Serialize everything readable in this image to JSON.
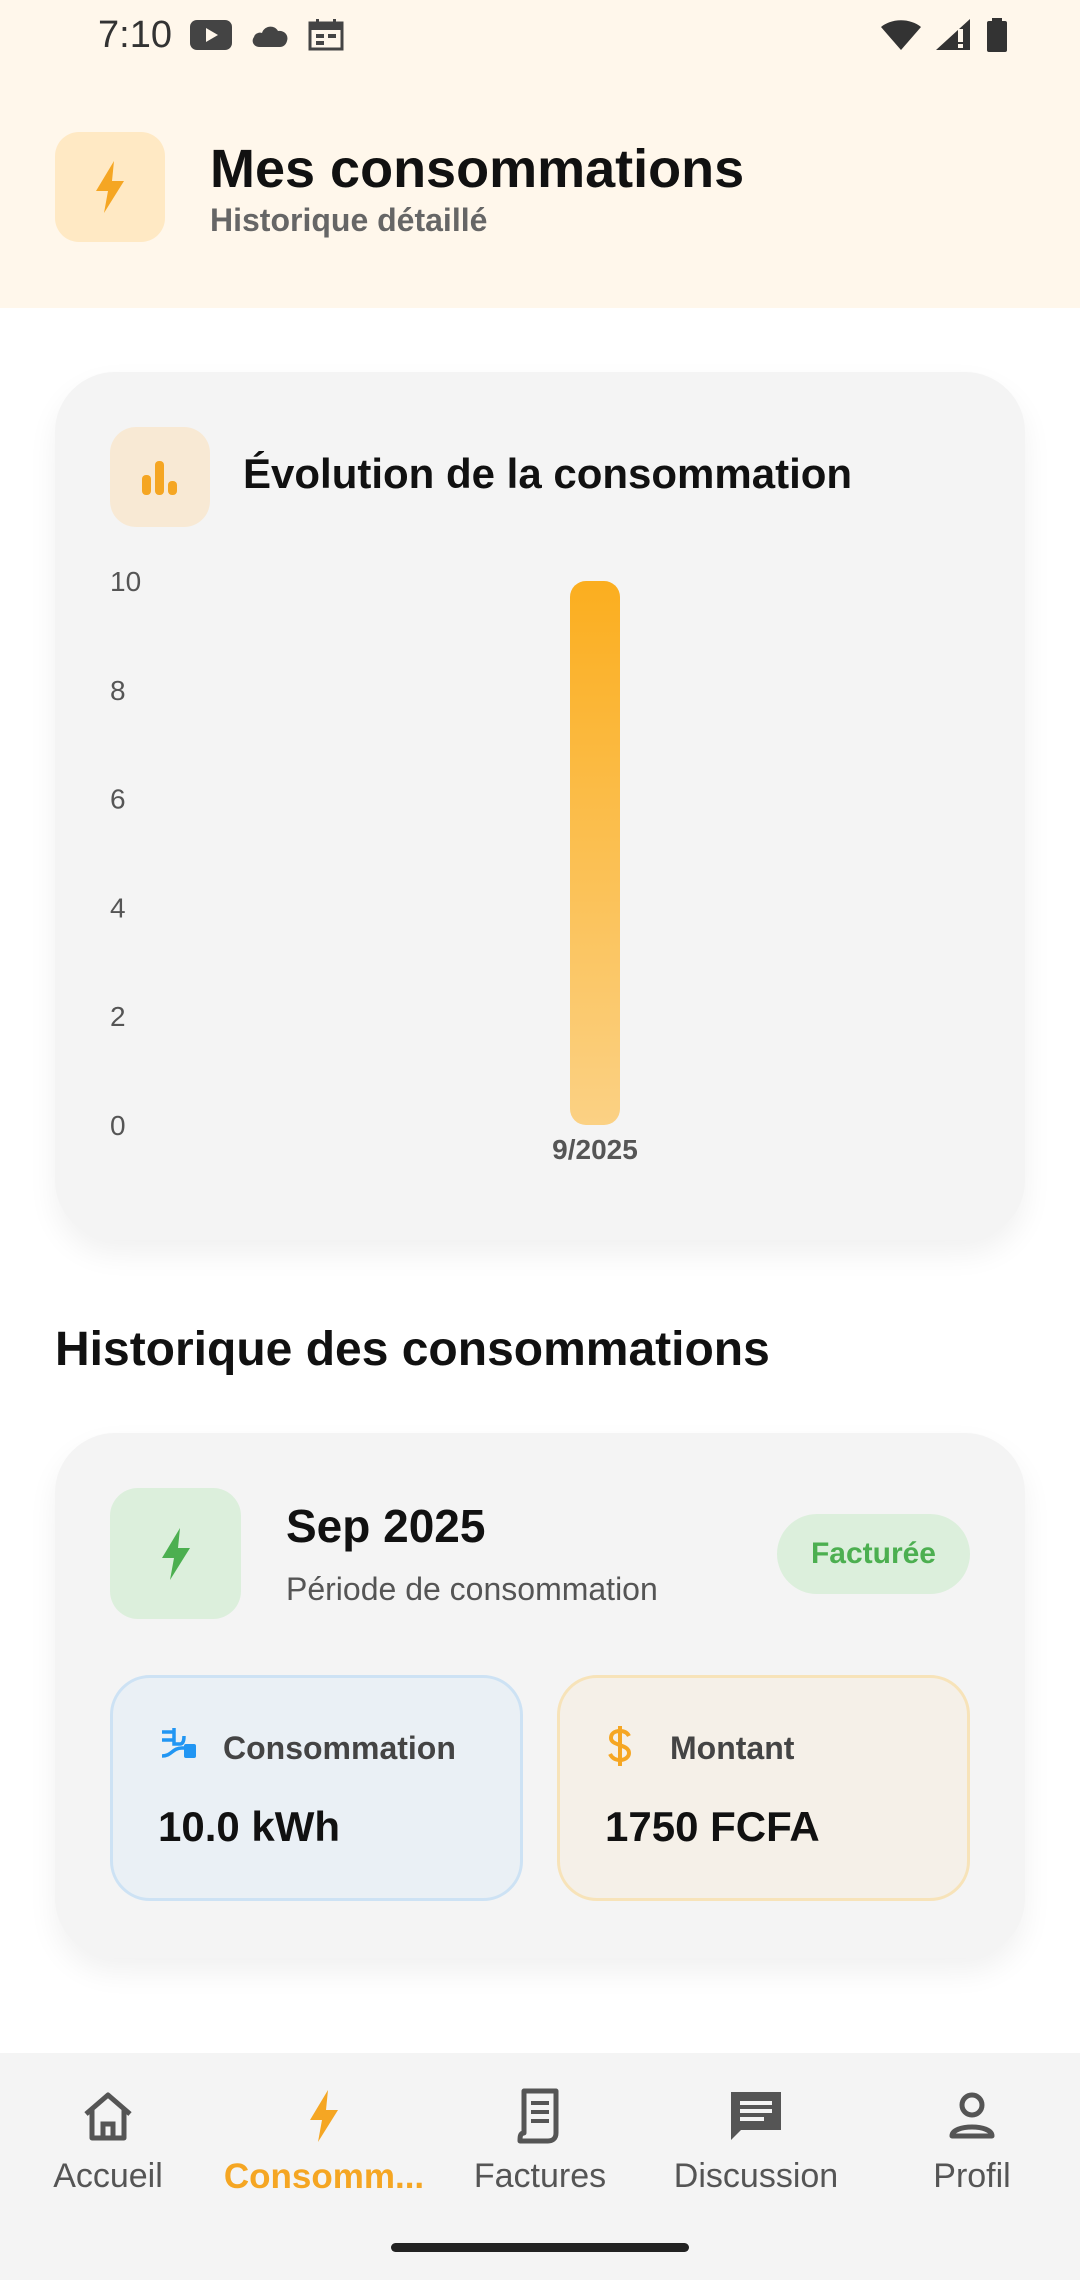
{
  "status_bar": {
    "time": "7:10"
  },
  "header": {
    "title": "Mes consommations",
    "subtitle": "Historique détaillé",
    "icon": "bolt-icon"
  },
  "chart_card": {
    "title": "Évolution de la consommation",
    "icon": "bar-chart-icon"
  },
  "chart_data": {
    "type": "bar",
    "categories": [
      "9/2025"
    ],
    "values": [
      10
    ],
    "title": "Évolution de la consommation",
    "xlabel": "",
    "ylabel": "",
    "ylim": [
      0,
      10
    ],
    "yticks": [
      0,
      2,
      4,
      6,
      8,
      10
    ],
    "grid": false,
    "bar_color_top": "#fbae1f",
    "bar_color_bottom": "#fbd184"
  },
  "history": {
    "section_title": "Historique des consommations",
    "items": [
      {
        "month": "Sep 2025",
        "period_label": "Période de consommation",
        "status": "Facturée",
        "consumption_label": "Consommation",
        "consumption_value": "10.0 kWh",
        "amount_label": "Montant",
        "amount_value": "1750 FCFA"
      }
    ]
  },
  "bottom_nav": {
    "items": [
      {
        "label": "Accueil",
        "icon": "home-icon",
        "active": false
      },
      {
        "label": "Consomm...",
        "icon": "bolt-icon",
        "active": true
      },
      {
        "label": "Factures",
        "icon": "receipt-icon",
        "active": false
      },
      {
        "label": "Discussion",
        "icon": "chat-icon",
        "active": false
      },
      {
        "label": "Profil",
        "icon": "person-icon",
        "active": false
      }
    ]
  },
  "colors": {
    "accent": "#f5a623",
    "success": "#4caf50",
    "info": "#2196f3"
  }
}
